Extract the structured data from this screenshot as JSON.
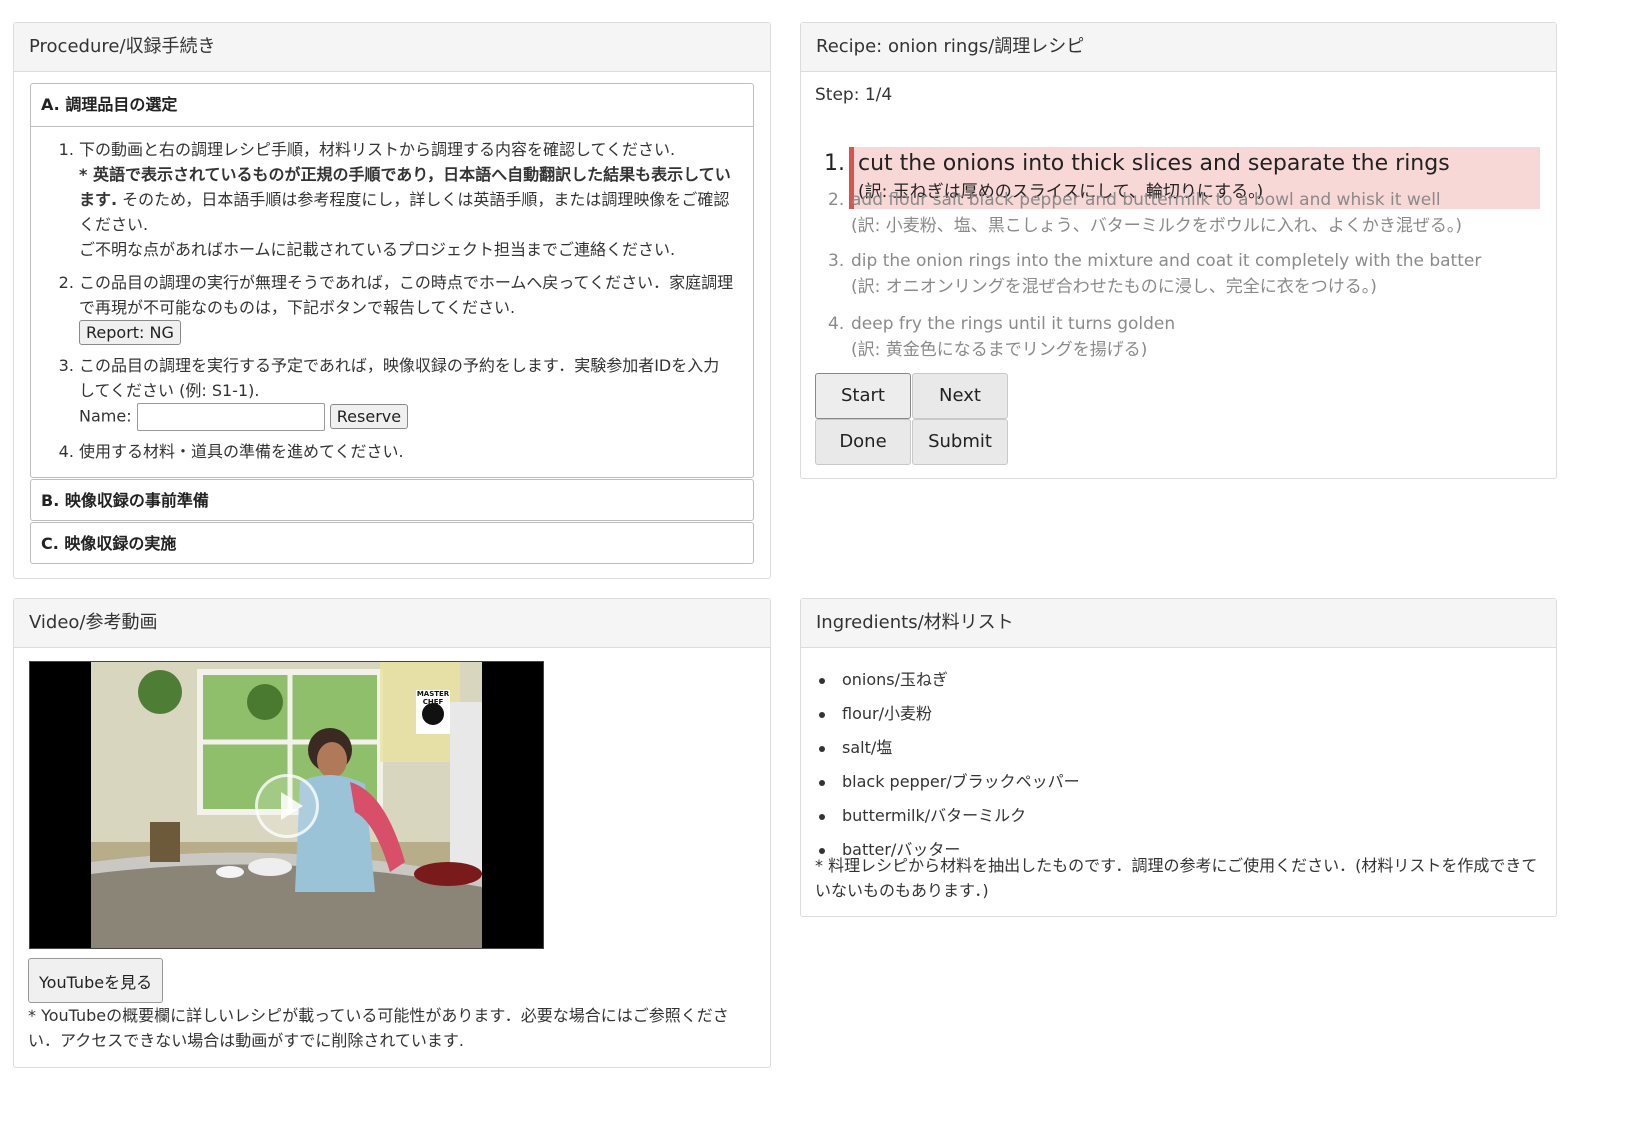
{
  "procedure": {
    "title": "Procedure/収録手続き",
    "section_a": {
      "title": "A. 調理品目の選定",
      "item1_text": "下の動画と右の調理レシピ手順，材料リストから調理する内容を確認してください.",
      "item1_bold": "* 英語で表示されているものが正規の手順であり，日本語へ自動翻訳した結果も表示しています.",
      "item1_rest": " そのため，日本語手順は参考程度にし，詳しくは英語手順，または調理映像をご確認ください.",
      "item1_contact": "ご不明な点があればホームに記載されているプロジェクト担当までご連絡ください.",
      "item2_text": "この品目の調理の実行が無理そうであれば，この時点でホームへ戻ってください．家庭調理で再現が不可能なのものは，下記ボタンで報告してください.",
      "report_button": "Report: NG",
      "item3_text": "この品目の調理を実行する予定であれば，映像収録の予約をします．実験参加者IDを入力してください (例: S1-1).",
      "name_label": "Name:",
      "name_value": "",
      "reserve_button": "Reserve",
      "item4_text": "使用する材料・道具の準備を進めてください."
    },
    "section_b": {
      "title": "B. 映像収録の事前準備"
    },
    "section_c": {
      "title": "C. 映像収録の実施"
    }
  },
  "recipe": {
    "title": "Recipe: onion rings/調理レシピ",
    "step_indicator": "Step: 1/4",
    "steps": [
      {
        "num": "1.",
        "en": "cut the onions into thick slices and separate the rings",
        "ja": "(訳: 玉ねぎは厚めのスライスにして、輪切りにする。)"
      },
      {
        "num": "2.",
        "en": "add flour salt black pepper and buttermilk to a bowl and whisk it well",
        "ja": "(訳: 小麦粉、塩、黒こしょう、バターミルクをボウルに入れ、よくかき混ぜる。)"
      },
      {
        "num": "3.",
        "en": "dip the onion rings into the mixture and coat it completely with the batter",
        "ja": "(訳: オニオンリングを混ぜ合わせたものに浸し、完全に衣をつける。)"
      },
      {
        "num": "4.",
        "en": "deep fry the rings until it turns golden",
        "ja": "(訳: 黄金色になるまでリングを揚げる)"
      }
    ],
    "buttons": {
      "start": "Start",
      "next": "Next",
      "done": "Done",
      "submit": "Submit"
    }
  },
  "video": {
    "title": "Video/参考動画",
    "logo_text": "MASTER CHEF",
    "youtube_button": "YouTubeを見る",
    "note": "* YouTubeの概要欄に詳しいレシピが載っている可能性があります．必要な場合にはご参照ください．アクセスできない場合は動画がすでに削除されています."
  },
  "ingredients": {
    "title": "Ingredients/材料リスト",
    "items": [
      "onions/玉ねぎ",
      "flour/小麦粉",
      "salt/塩",
      "black pepper/ブラックペッパー",
      "buttermilk/バターミルク",
      "batter/バッター"
    ],
    "note": "* 料理レシピから材料を抽出したものです．調理の参考にご使用ください．(材料リストを作成できていないものもあります．)"
  },
  "colors": {
    "active_step_bg": "#f8d7d7",
    "active_step_border": "#d9534f",
    "panel_header_bg": "#f5f5f5"
  }
}
